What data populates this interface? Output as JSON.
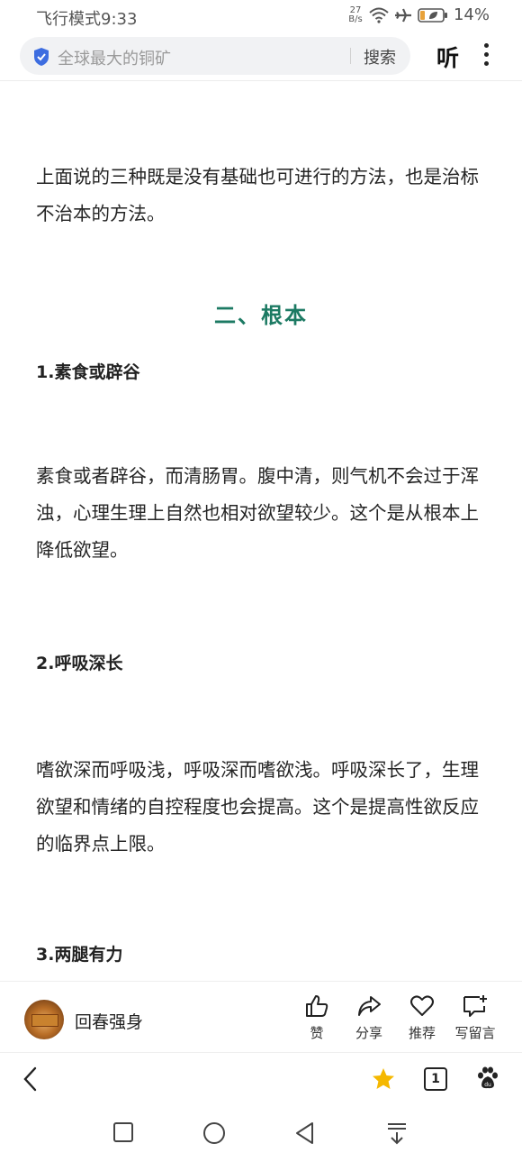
{
  "status_bar": {
    "left_text": "飞行模式9:33",
    "net_speed_value": "27",
    "net_speed_unit": "B/s",
    "battery": "14%"
  },
  "search_bar": {
    "query": "全球最大的铜矿",
    "search_label": "搜索",
    "listen_label": "听"
  },
  "article": {
    "para1": "上面说的三种既是没有基础也可进行的方法，也是治标不治本的方法。",
    "section_heading": "二、根本",
    "sub1": "1.素食或辟谷",
    "para2": "素食或者辟谷，而清肠胃。腹中清，则气机不会过于浑浊，心理生理上自然也相对欲望较少。这个是从根本上降低欲望。",
    "sub2": "2.呼吸深长",
    "para3": "嗜欲深而呼吸浅，呼吸深而嗜欲浅。呼吸深长了，生理欲望和情绪的自控程度也会提高。这个是提高性欲反应的临界点上限。",
    "sub3": "3.两腿有力"
  },
  "author_bar": {
    "name": "回春强身",
    "actions": [
      {
        "label": "赞",
        "icon": "thumbs-up-icon"
      },
      {
        "label": "分享",
        "icon": "share-icon"
      },
      {
        "label": "推荐",
        "icon": "heart-icon"
      },
      {
        "label": "写留言",
        "icon": "comment-icon"
      }
    ]
  },
  "bottom_nav": {
    "tab_count": "1",
    "star_color": "#f5b800"
  }
}
